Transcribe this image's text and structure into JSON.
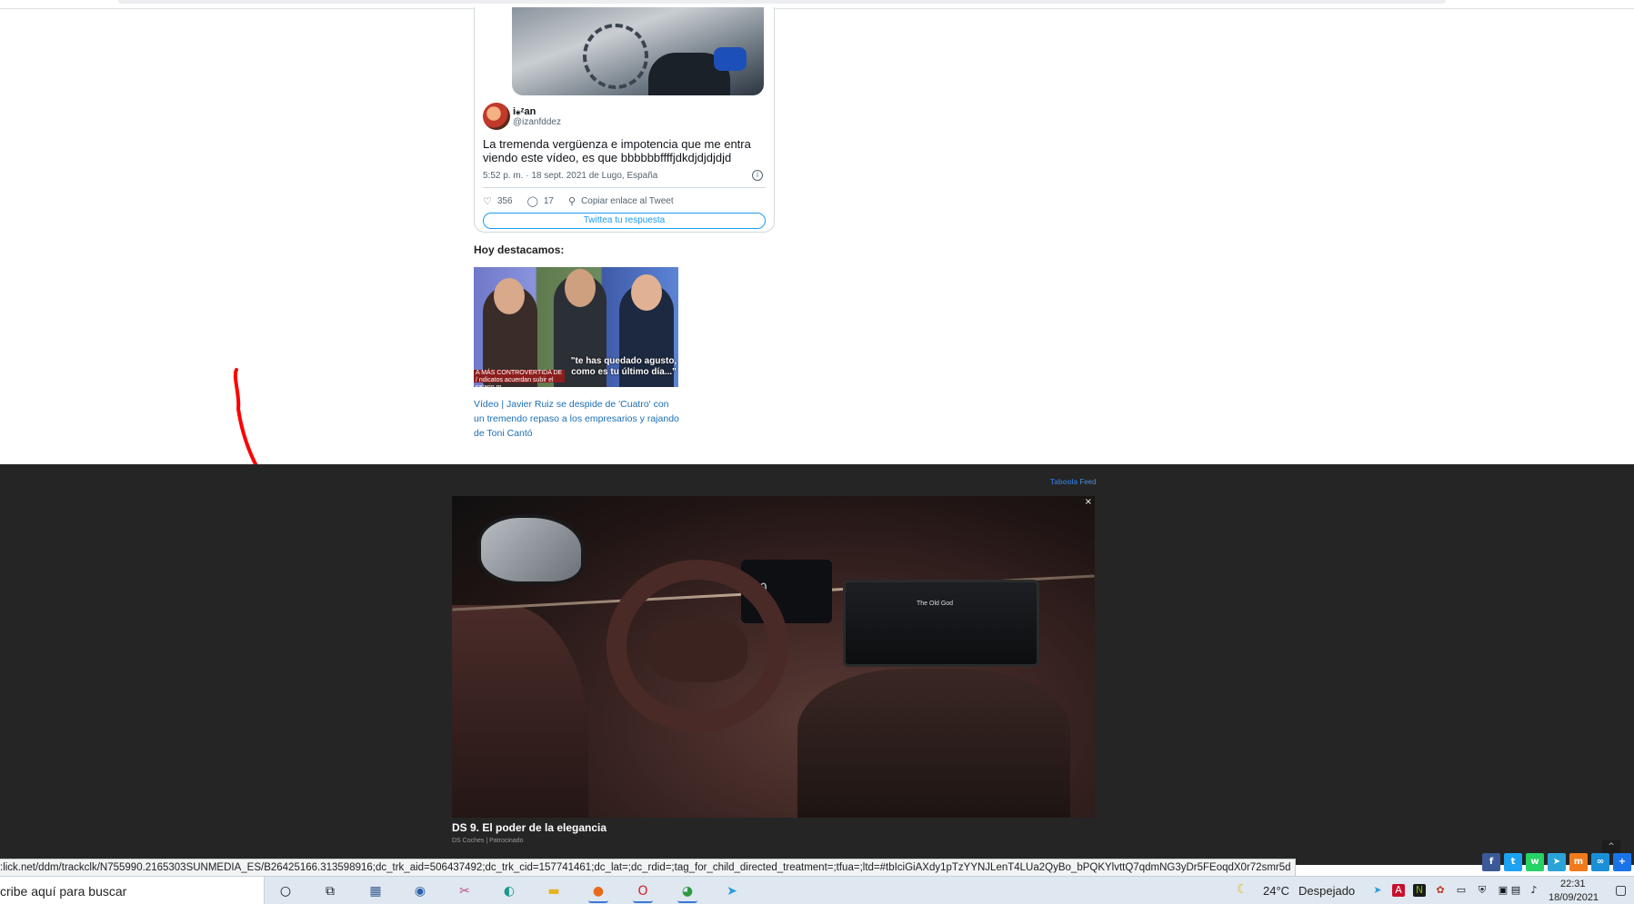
{
  "tweet": {
    "author_name": "i⁎ᶻan",
    "author_handle": "@izanfddez",
    "text": "La tremenda vergüenza e impotencia que me entra viendo este vídeo, es que bbbbbbffffjdkdjdjdjdjd",
    "timestamp": "5:52 p. m. · 18 sept. 2021 de Lugo, España",
    "likes": "356",
    "replies": "17",
    "copy_link_label": "Copiar enlace al Tweet",
    "reply_button_label": "Twittea tu respuesta"
  },
  "highlight": {
    "heading": "Hoy destacamos:",
    "image_band_text": "A MÁS CONTROVERTIDA DE / ndicatos acuerdan subir el salario m",
    "image_quote": "\"te has quedado agusto, como es tu último día...\"",
    "link_text": "Vídeo | Javier Ruiz se despide de 'Cuatro' con un tremendo repaso a los empresarios y rajando de Toni Cantó"
  },
  "ad": {
    "provider": "Taboola",
    "provider_suffix": "Feed",
    "close_label": "×",
    "screen_title": "The Old God",
    "cluster_value": "00",
    "title": "DS 9. El poder de la elegancia",
    "source": "DS Coches | Patrocinado"
  },
  "scroll_up_label": "^",
  "share_bar": [
    {
      "icon": "facebook-icon",
      "glyph": "f",
      "color": "#3b5998"
    },
    {
      "icon": "twitter-icon",
      "glyph": "t",
      "color": "#1da1f2"
    },
    {
      "icon": "whatsapp-icon",
      "glyph": "w",
      "color": "#25d366"
    },
    {
      "icon": "telegram-icon",
      "glyph": "➤",
      "color": "#2aa3d8"
    },
    {
      "icon": "meneame-icon",
      "glyph": "m",
      "color": "#f07a1c"
    },
    {
      "icon": "copy-link-icon",
      "glyph": "∞",
      "color": "#1a8fd8"
    },
    {
      "icon": "more-share-icon",
      "glyph": "+",
      "color": "#1a73e8"
    }
  ],
  "status_url": ":lick.net/ddm/trackclk/N755990.2165303SUNMEDIA_ES/B26425166.313598916;dc_trk_aid=506437492;dc_trk_cid=157741461;dc_lat=;dc_rdid=;tag_for_child_directed_treatment=;tfua=;ltd=#tbIciGiAXdy1pTzYYNJLenT4LUa2QyBo_bPQKYlvttQ7qdmNG3yDr5FEoqdX0r72smr5d",
  "taskbar": {
    "search_placeholder": "cribe aquí para buscar",
    "weather_temp": "24°C",
    "weather_desc": "Despejado",
    "clock_time": "22:31",
    "clock_date": "18/09/2021"
  },
  "colors": {
    "tweet_link": "#1d9bf0",
    "ad_background": "#252525",
    "annotation_red": "#ff0000"
  }
}
